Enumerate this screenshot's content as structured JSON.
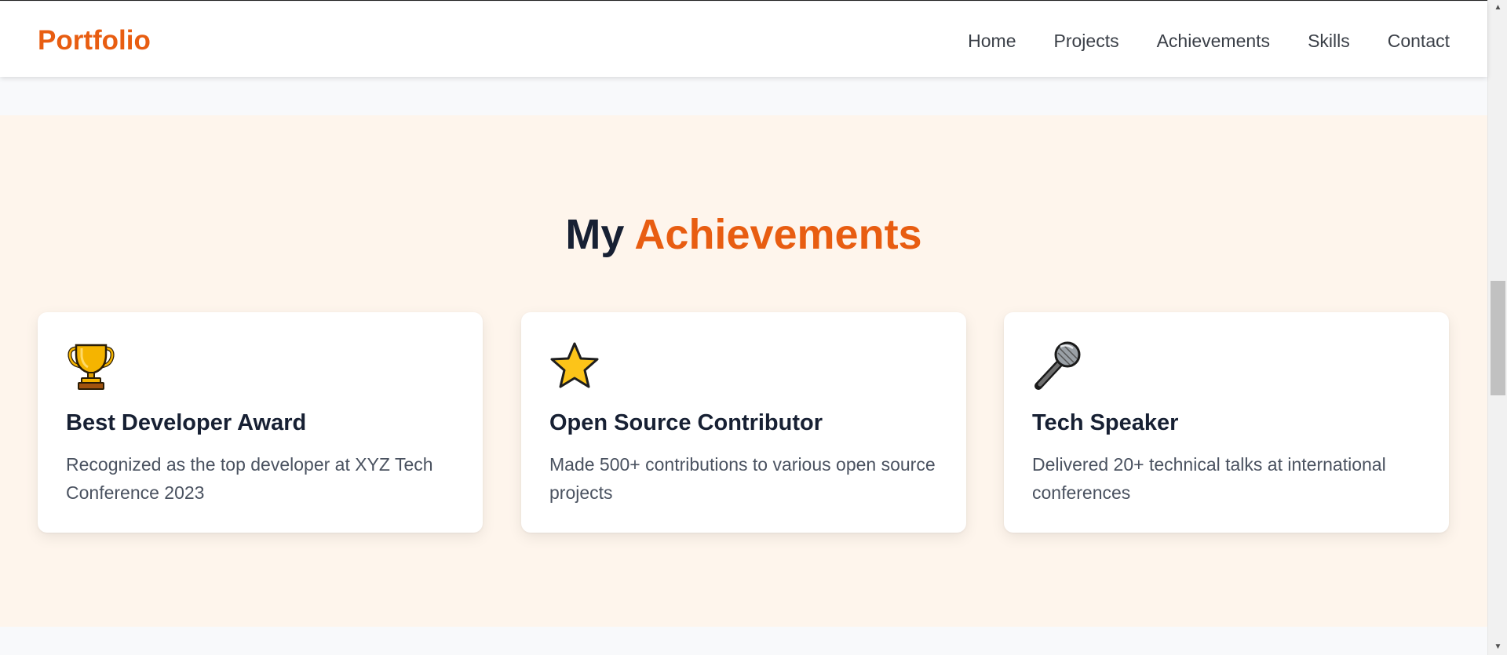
{
  "brand": "Portfolio",
  "nav": {
    "items": [
      {
        "label": "Home"
      },
      {
        "label": "Projects"
      },
      {
        "label": "Achievements"
      },
      {
        "label": "Skills"
      },
      {
        "label": "Contact"
      }
    ]
  },
  "achievements": {
    "title_prefix": "My",
    "title_accent": "Achievements",
    "cards": [
      {
        "icon": "trophy-icon",
        "title": "Best Developer Award",
        "description": "Recognized as the top developer at XYZ Tech Conference 2023"
      },
      {
        "icon": "star-icon",
        "title": "Open Source Contributor",
        "description": "Made 500+ contributions to various open source projects"
      },
      {
        "icon": "microphone-icon",
        "title": "Tech Speaker",
        "description": "Delivered 20+ technical talks at international conferences"
      }
    ]
  },
  "colors": {
    "accent": "#e85d11",
    "heading": "#172033",
    "section_bg": "#fef5ec"
  }
}
